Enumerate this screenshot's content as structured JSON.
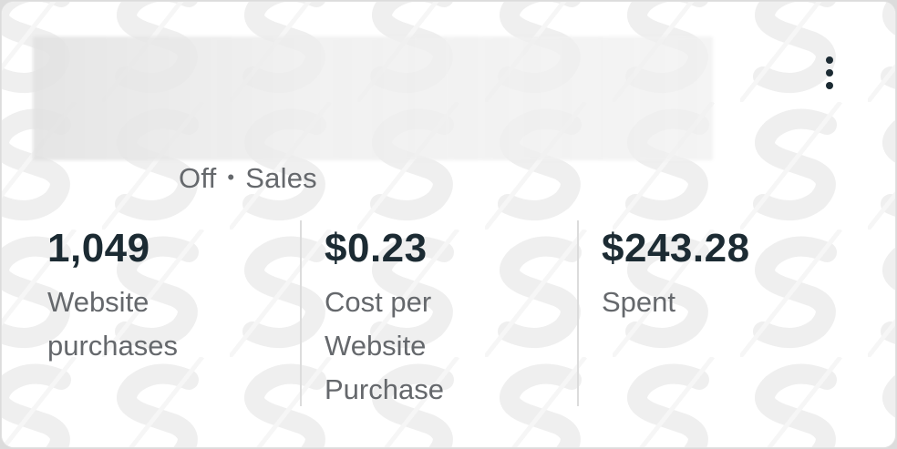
{
  "card": {
    "title_blurred": true,
    "more_icon": "vertical-ellipsis-icon",
    "subtitle": {
      "status": "Off",
      "separator": "•",
      "objective": "Sales"
    },
    "metrics": [
      {
        "value": "1,049",
        "label": "Website purchases"
      },
      {
        "value": "$0.23",
        "label": "Cost per Website Purchase"
      },
      {
        "value": "$243.28",
        "label": "Spent"
      }
    ]
  },
  "colors": {
    "value_text": "#1c2b33",
    "label_text": "#65686c",
    "divider": "#dcdcdc",
    "card_background": "#ffffff"
  }
}
